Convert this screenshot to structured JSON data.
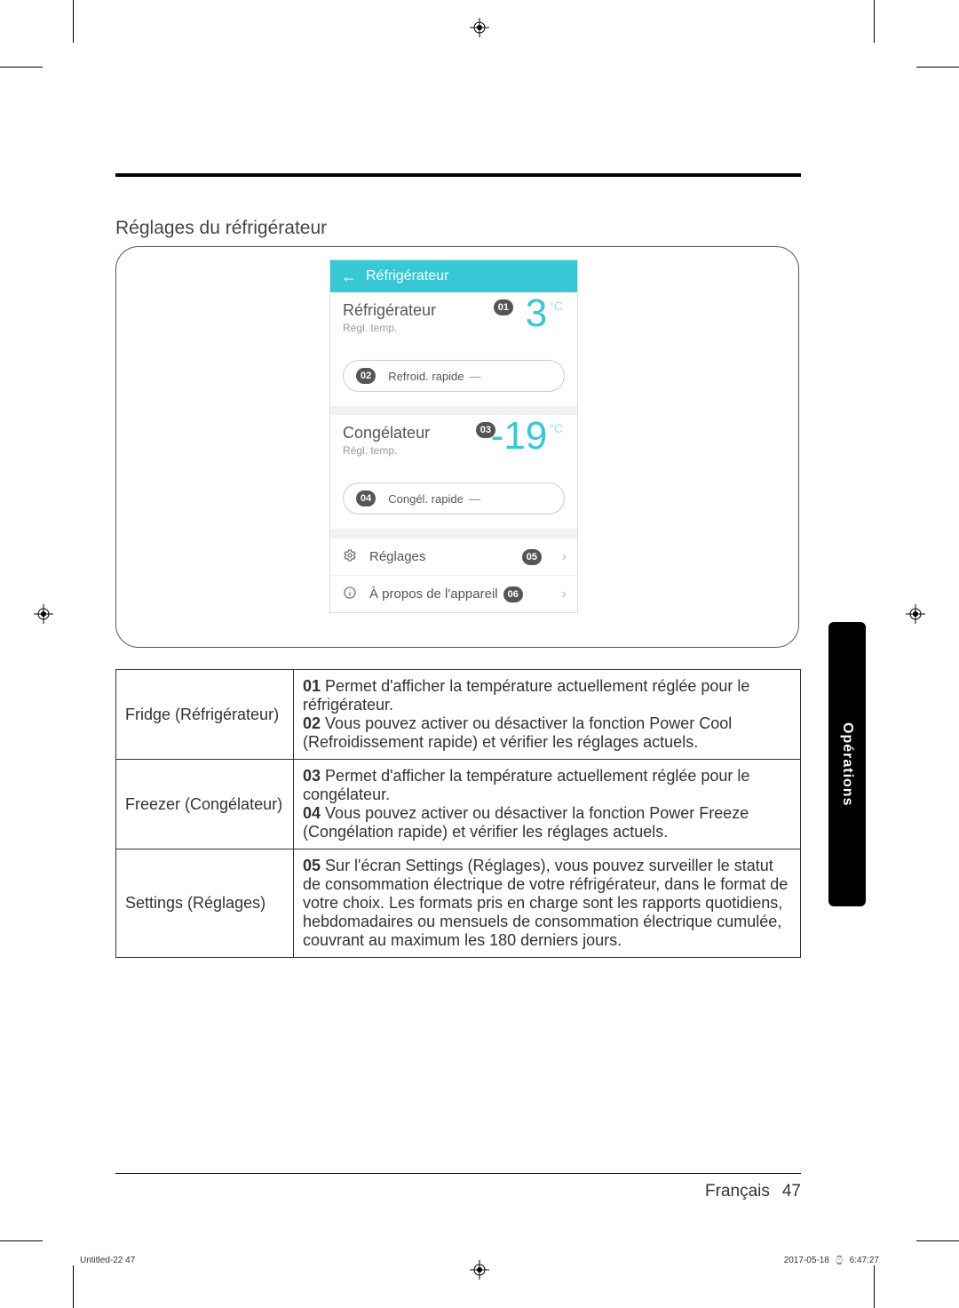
{
  "section_title": "Réglages du réfrigérateur",
  "app": {
    "header_title": "Réfrigérateur",
    "fridge": {
      "title": "Réfrigérateur",
      "subtitle": "Régl. temp.",
      "badge": "01",
      "temp_value": "3",
      "temp_unit": "°C",
      "quick_badge": "02",
      "quick_label": "Refroid. rapide",
      "quick_state": "—"
    },
    "freezer": {
      "title": "Congélateur",
      "subtitle": "Régl. temp.",
      "badge": "03",
      "temp_value": "-19",
      "temp_unit": "°C",
      "quick_badge": "04",
      "quick_label": "Congél. rapide",
      "quick_state": "—"
    },
    "menu": {
      "settings_label": "Réglages",
      "settings_badge": "05",
      "about_label": "À propos de l'appareil",
      "about_badge": "06"
    }
  },
  "table": {
    "rows": [
      {
        "label": "Fridge (Réfrigérateur)",
        "items": [
          {
            "num": "01",
            "text": "Permet d'afficher la température actuellement réglée pour le réfrigérateur."
          },
          {
            "num": "02",
            "text": "Vous pouvez activer ou désactiver la fonction Power Cool (Refroidissement rapide) et vérifier les réglages actuels."
          }
        ]
      },
      {
        "label": "Freezer (Congélateur)",
        "items": [
          {
            "num": "03",
            "text": "Permet d'afficher la température actuellement réglée pour le congélateur."
          },
          {
            "num": "04",
            "text": "Vous pouvez activer ou désactiver la fonction Power Freeze (Congélation rapide) et vérifier les réglages actuels."
          }
        ]
      },
      {
        "label": "Settings (Réglages)",
        "items": [
          {
            "num": "05",
            "text": "Sur l'écran Settings (Réglages), vous pouvez surveiller le statut de consommation électrique de votre réfrigérateur, dans le format de votre choix. Les formats pris en charge sont les rapports quotidiens, hebdomadaires ou mensuels de consommation électrique cumulée, couvrant au maximum les 180 derniers jours."
          }
        ]
      }
    ]
  },
  "side_tab": "Opérations",
  "footer": {
    "language": "Français",
    "page": "47"
  },
  "slug": {
    "left": "Untitled-22   47",
    "right_date": "2017-05-18",
    "right_time": "6:47:27"
  }
}
